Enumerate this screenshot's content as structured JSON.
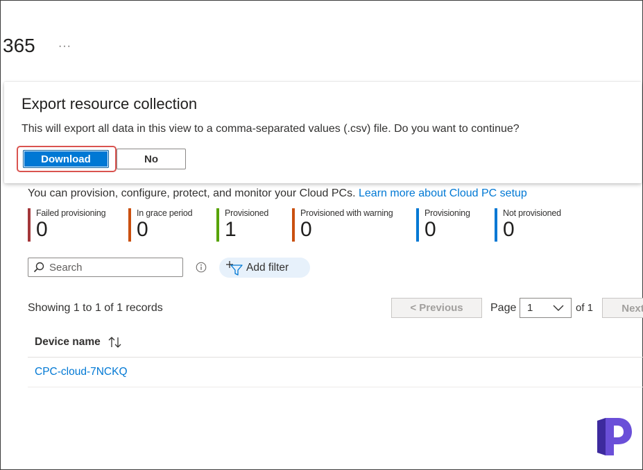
{
  "page": {
    "title": "365",
    "more_label": "···"
  },
  "dialog": {
    "title": "Export resource collection",
    "message": "This will export all data in this view to a comma-separated values (.csv) file. Do you want to continue?",
    "primary_button": "Download",
    "secondary_button": "No",
    "highlight_color": "#d9534f"
  },
  "intro": {
    "text": "You can provision, configure, protect, and monitor your Cloud PCs. ",
    "link": "Learn more about Cloud PC setup"
  },
  "status_cards": [
    {
      "label": "Failed provisioning",
      "count": "0",
      "color": "#a4373a"
    },
    {
      "label": "In grace period",
      "count": "0",
      "color": "#ca5010"
    },
    {
      "label": "Provisioned",
      "count": "1",
      "color": "#57a300"
    },
    {
      "label": "Provisioned with warning",
      "count": "0",
      "color": "#ca5010"
    },
    {
      "label": "Provisioning",
      "count": "0",
      "color": "#0078d4"
    },
    {
      "label": "Not provisioned",
      "count": "0",
      "color": "#0078d4"
    }
  ],
  "search": {
    "placeholder": "Search"
  },
  "filter": {
    "label": "Add filter"
  },
  "pagination": {
    "records_text": "Showing 1 to 1 of 1 records",
    "previous_label": "< Previous",
    "page_label": "Page",
    "page_value": "1",
    "of_label": "of 1",
    "next_label": "Next >"
  },
  "table": {
    "columns": [
      "Device name"
    ],
    "rows": [
      {
        "device_name": "CPC-cloud-7NCKQ"
      }
    ]
  },
  "colors": {
    "accent": "#0078d4",
    "logo": "#5b3fd0"
  },
  "icons": [
    "more-icon",
    "search-icon",
    "info-icon",
    "filter-icon",
    "chevron-down-icon",
    "sort-icon",
    "logo-icon"
  ]
}
